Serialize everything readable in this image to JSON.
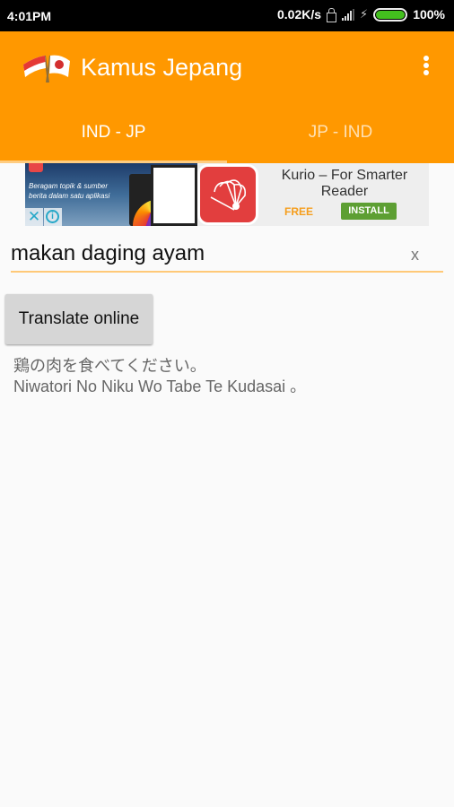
{
  "status_bar": {
    "time": "4:01PM",
    "net_speed": "0.02K/s",
    "battery_percent": "100%",
    "battery_level": 1.0,
    "icons": [
      "lock-icon",
      "signal-icon",
      "charging-bolt-icon",
      "battery-icon"
    ]
  },
  "app_bar": {
    "title": "Kamus Jepang",
    "logo_icon": "crossed-flags-indonesia-japan",
    "menu_icon": "overflow-menu-icon"
  },
  "tabs": [
    {
      "label": "IND - JP",
      "active": true
    },
    {
      "label": "JP - IND",
      "active": false
    }
  ],
  "ad": {
    "tagline": "Beragam topik & sumber berita dalam satu aplikasi",
    "title": "Kurio – For Smarter Reader",
    "price": "FREE",
    "install_label": "INSTALL",
    "close_icon": "✕",
    "info_icon": "i"
  },
  "search": {
    "value": "makan daging ayam",
    "clear_label": "x"
  },
  "translate_button": {
    "label": "Translate online"
  },
  "result": {
    "japanese": "鶏の肉を食べてください。",
    "romaji": "Niwatori No Niku Wo Tabe Te Kudasai 。"
  },
  "colors": {
    "primary": "#ff9800",
    "tab_indicator": "#ffcc80",
    "input_underline": "#ffc978",
    "install_green": "#5d9f33",
    "free_orange": "#f59e1d"
  }
}
